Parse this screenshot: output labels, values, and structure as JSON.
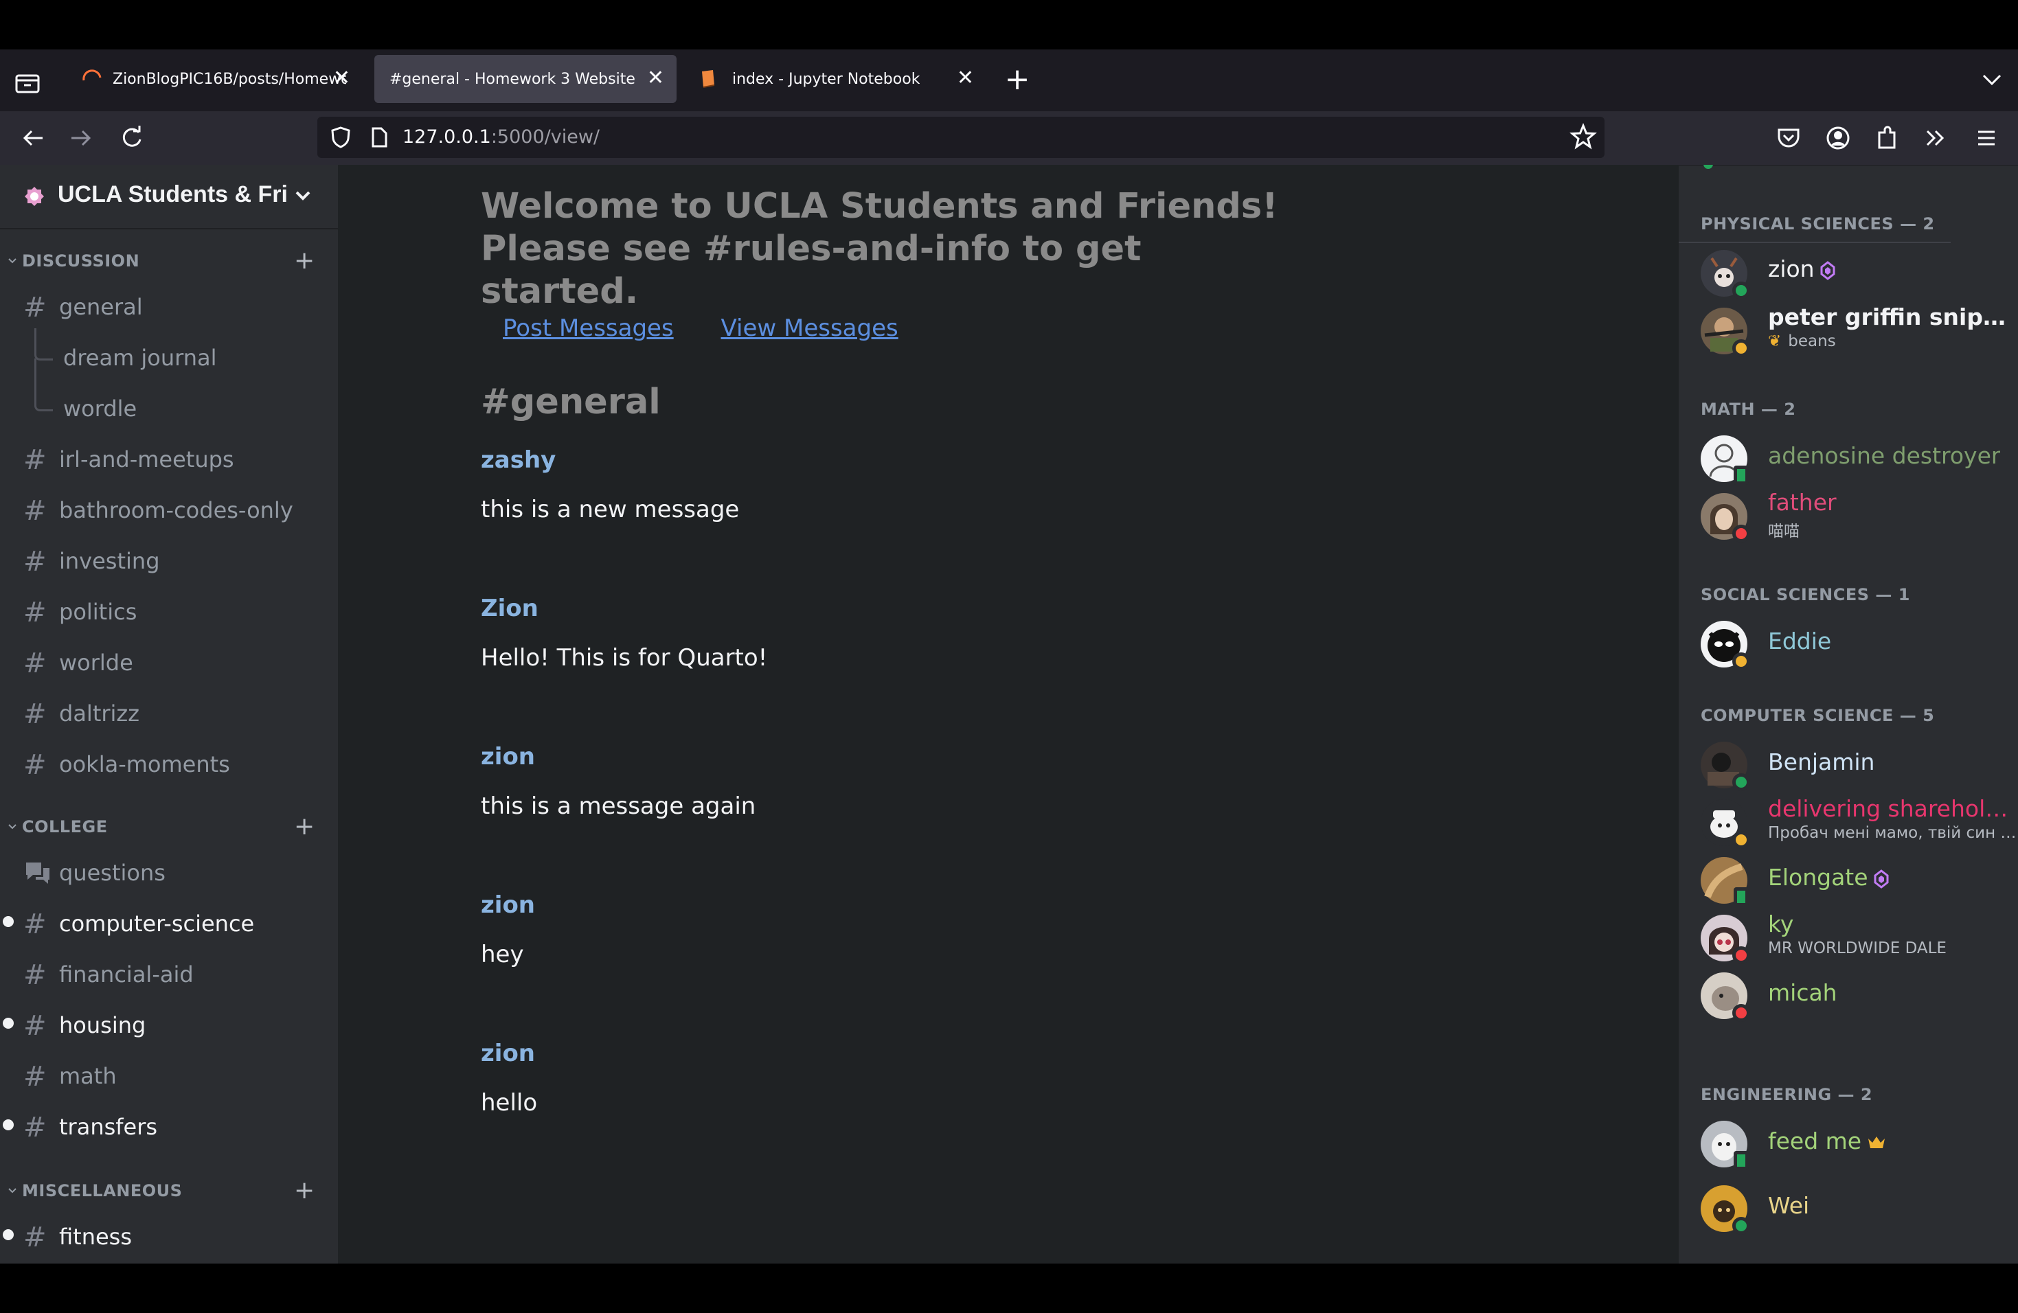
{
  "browser": {
    "tabs": [
      {
        "title": "ZionBlogPIC16B/posts/Homewo",
        "close": "✕"
      },
      {
        "title": "#general - Homework 3 Website",
        "close": "✕"
      },
      {
        "title": "index - Jupyter Notebook",
        "close": "✕"
      }
    ],
    "new_tab": "+",
    "url_host": "127.0.0.1",
    "url_rest": ":5000/view/"
  },
  "server": {
    "name": "UCLA Students & Friends",
    "categories": [
      {
        "label": "DISCUSSION",
        "plus": "+",
        "channels": [
          {
            "label": "general",
            "hash": "#"
          },
          {
            "label": "dream journal"
          },
          {
            "label": "wordle"
          },
          {
            "label": "irl-and-meetups",
            "hash": "#"
          },
          {
            "label": "bathroom-codes-only",
            "hash": "#"
          },
          {
            "label": "investing",
            "hash": "#"
          },
          {
            "label": "politics",
            "hash": "#"
          },
          {
            "label": "worlde",
            "hash": "#"
          },
          {
            "label": "daltrizz",
            "hash": "#"
          },
          {
            "label": "ookla-moments",
            "hash": "#"
          }
        ]
      },
      {
        "label": "COLLEGE",
        "plus": "+",
        "channels": [
          {
            "label": "questions"
          },
          {
            "label": "computer-science",
            "hash": "#"
          },
          {
            "label": "financial-aid",
            "hash": "#"
          },
          {
            "label": "housing",
            "hash": "#"
          },
          {
            "label": "math",
            "hash": "#"
          },
          {
            "label": "transfers",
            "hash": "#"
          }
        ]
      },
      {
        "label": "MISCELLANEOUS",
        "plus": "+",
        "channels": [
          {
            "label": "fitness",
            "hash": "#"
          }
        ]
      }
    ]
  },
  "main": {
    "welcome_line1": "Welcome to UCLA Students and Friends!",
    "welcome_line2": "Please see #rules-and-info to get started.",
    "links": {
      "post": "Post Messages",
      "view": "View Messages"
    },
    "channel_heading": "#general",
    "messages": [
      {
        "author": "zashy",
        "text": "this is a new message"
      },
      {
        "author": "Zion",
        "text": "Hello! This is for Quarto!"
      },
      {
        "author": "zion",
        "text": "this is a message again"
      },
      {
        "author": "zion",
        "text": "hey"
      },
      {
        "author": "zion",
        "text": "hello"
      }
    ]
  },
  "members": {
    "roles": [
      {
        "label": "PHYSICAL SCIENCES — 2"
      },
      {
        "label": "MATH — 2"
      },
      {
        "label": "SOCIAL SCIENCES — 1"
      },
      {
        "label": "COMPUTER SCIENCE — 5"
      },
      {
        "label": "ENGINEERING — 2"
      }
    ],
    "list": [
      {
        "name": "zion",
        "color": "#f2f3f5",
        "status": "online"
      },
      {
        "name": "peter griffin sniper rifle",
        "sub": "beans",
        "color": "#f2f3f5",
        "status": "idle"
      },
      {
        "name": "adenosine destroyer",
        "color": "#7f9e6e",
        "status": "mobile"
      },
      {
        "name": "father",
        "sub": "喵喵",
        "color": "#e04d7a",
        "status": "dnd"
      },
      {
        "name": "Eddie",
        "color": "#8fc8d8",
        "status": "idle"
      },
      {
        "name": "Benjamin",
        "color": "#cfe3f5",
        "status": "online"
      },
      {
        "name": "delivering shareholde...",
        "sub": "Пробач мені мамо, твій син - ...",
        "color": "#e8366e",
        "status": "idle"
      },
      {
        "name": "Elongate",
        "color": "#a3d37a",
        "status": "mobile"
      },
      {
        "name": "ky",
        "sub": "MR WORLDWIDE DALE",
        "color": "#a3d37a",
        "status": "dnd"
      },
      {
        "name": "micah",
        "color": "#a3d37a",
        "status": "dnd"
      },
      {
        "name": "feed me",
        "color": "#a3d37a",
        "status": "mobile"
      },
      {
        "name": "Wei",
        "color": "#e8d48a",
        "status": "online"
      }
    ]
  },
  "colors": {
    "accent_link": "#5c8fe0",
    "author": "#8ab4e0",
    "sidebar_bg": "#2b2d31",
    "content_bg": "#1f2224"
  }
}
